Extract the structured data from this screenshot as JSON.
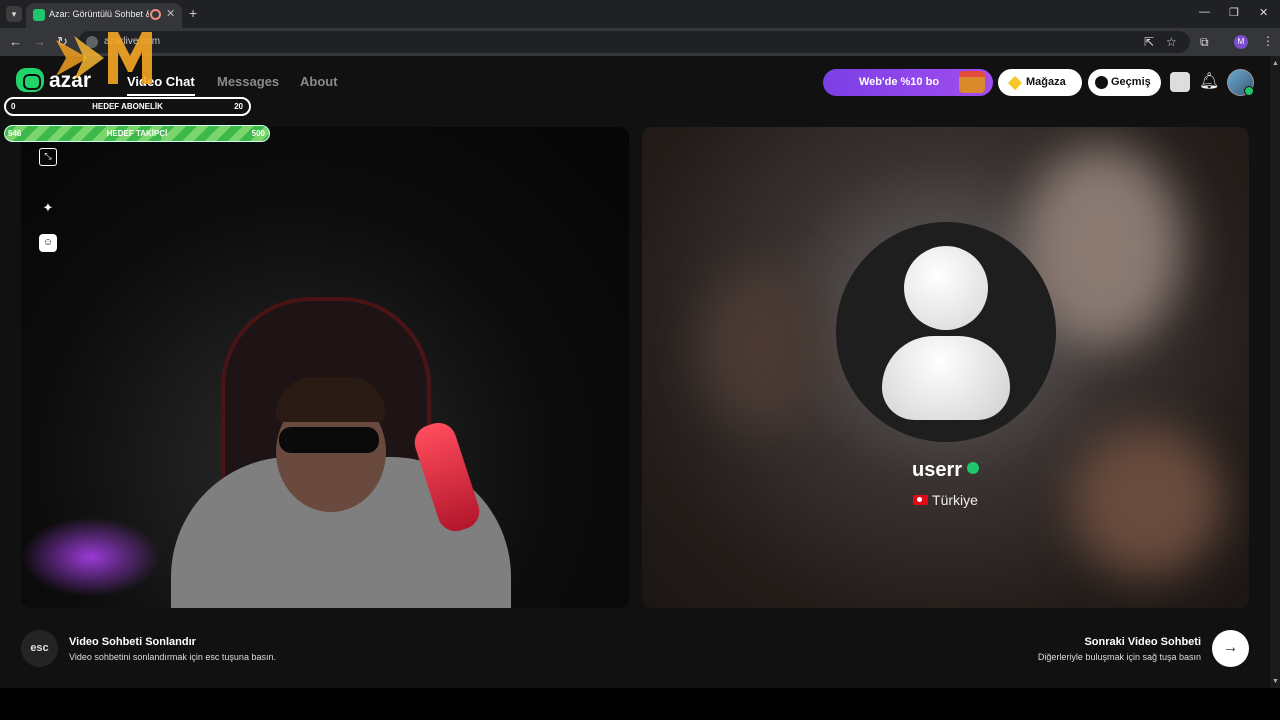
{
  "browser": {
    "tab_title": "Azar: Görüntülü Sohbet & V",
    "url": "azarlive.com",
    "profile_initial": "M"
  },
  "header": {
    "logo_text": "azar",
    "nav": [
      {
        "label": "Video Chat",
        "active": true
      },
      {
        "label": "Messages",
        "active": false
      },
      {
        "label": "About",
        "active": false
      }
    ],
    "promo_label": "Web'de %10 bo",
    "store_label": "Mağaza",
    "history_label": "Geçmiş"
  },
  "overlays": {
    "subscriber_goal": {
      "label": "HEDEF ABONELİK",
      "current": "0",
      "target": "20"
    },
    "follower_goal": {
      "label": "HEDEF TAKİPÇİ",
      "current": "546",
      "target": "500"
    }
  },
  "partner": {
    "username": "userr",
    "country": "Türkiye"
  },
  "footer": {
    "esc_key": "esc",
    "end_title": "Video Sohbeti Sonlandır",
    "end_subtitle": "Video sohbetini sonlandırmak için esc tuşuna basın.",
    "next_title": "Sonraki Video Sohbeti",
    "next_subtitle": "Diğerleriyle buluşmak için sağ tuşa basın"
  },
  "colors": {
    "brand_green": "#21d36b",
    "promo_purple": "#8b44ea",
    "goal_green": "#3db84a"
  }
}
